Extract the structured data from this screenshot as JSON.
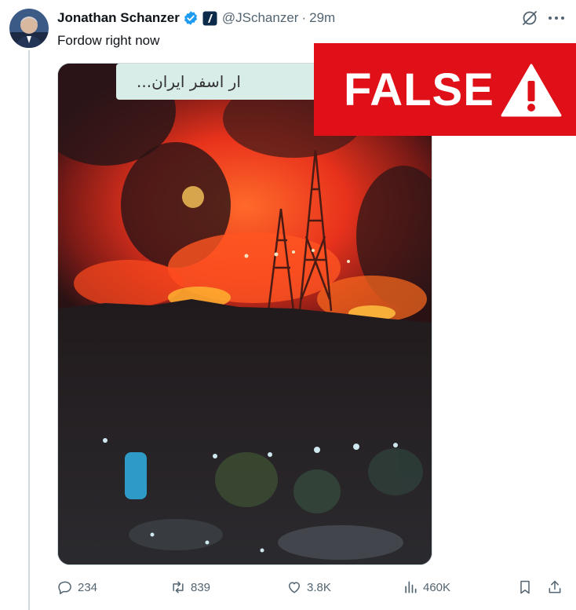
{
  "tweet": {
    "author": {
      "display_name": "Jonathan Schanzer",
      "handle": "@JSchanzer",
      "verified": true
    },
    "separator": "·",
    "timestamp": "29m",
    "text": "Fordow right now",
    "media": {
      "overlay_caption": "...ار اسفر ایران"
    },
    "fact_check_label": "FALSE",
    "metrics": {
      "replies": "234",
      "retweets": "839",
      "likes": "3.8K",
      "views": "460K"
    }
  },
  "colors": {
    "verified_blue": "#1d9bf0",
    "false_red": "#e01019",
    "muted_text": "#536471",
    "text": "#0f1419"
  },
  "icons": [
    "verified-badge-icon",
    "affiliate-badge-icon",
    "grok-icon",
    "more-icon",
    "reply-icon",
    "retweet-icon",
    "like-icon",
    "views-icon",
    "bookmark-icon",
    "share-icon",
    "warning-icon"
  ]
}
